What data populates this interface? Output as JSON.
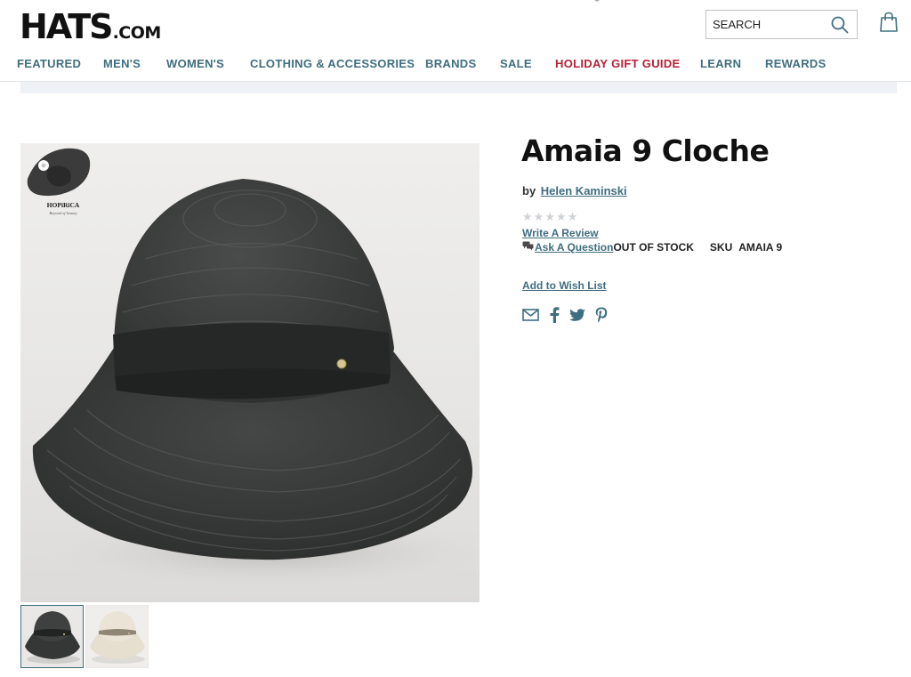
{
  "header": {
    "logo_main": "HATS",
    "logo_suffix": ".COM",
    "search_placeholder": "SEARCH",
    "icons": [
      "search-icon",
      "shopping-bag-icon"
    ]
  },
  "nav": {
    "items": [
      "FEATURED",
      "MEN'S",
      "WOMEN'S",
      "CLOTHING & ACCESSORIES",
      "BRANDS",
      "SALE",
      "HOLIDAY GIFT GUIDE",
      "LEARN",
      "REWARDS"
    ]
  },
  "product": {
    "title": "Amaia 9 Cloche",
    "by_prefix": "by",
    "brand": "Helen Kaminski",
    "rating": 0,
    "rating_max": 5,
    "write_review": "Write A Review",
    "ask_question": "Ask A Question",
    "stock_status": "OUT OF STOCK",
    "sku_label": "SKU",
    "sku_value": "AMAIA 9",
    "wishlist": "Add to Wish List",
    "share_icons": [
      "email-icon",
      "facebook-icon",
      "twitter-icon",
      "pinterest-icon"
    ]
  },
  "gallery": {
    "watermark": "HOPiRiCA",
    "watermark_tagline": "Beyond of beauty",
    "thumbnails": [
      "black-cloche-thumbnail",
      "cream-cloche-thumbnail"
    ]
  },
  "colors": {
    "link": "#3f6e80",
    "holiday": "#b42236",
    "hat_black": "#3a3c3b",
    "hat_cream": "#e9e2d4"
  }
}
